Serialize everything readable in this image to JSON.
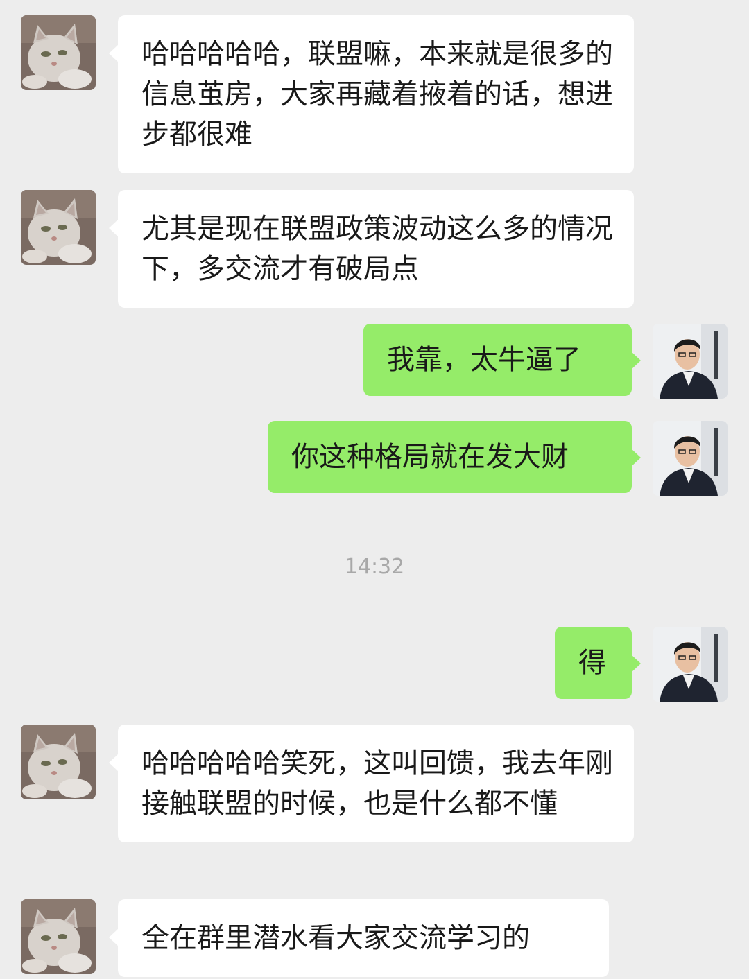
{
  "messages": [
    {
      "sender": "contact",
      "avatar": "cat-avatar",
      "text": "哈哈哈哈哈，联盟嘛，本来就是很多的信息茧房，大家再藏着掖着的话，想进步都很难"
    },
    {
      "sender": "contact",
      "avatar": "cat-avatar",
      "text": "尤其是现在联盟政策波动这么多的情况下，多交流才有破局点"
    },
    {
      "sender": "me",
      "avatar": "man-avatar",
      "text": "我靠，太牛逼了"
    },
    {
      "sender": "me",
      "avatar": "man-avatar",
      "text": "你这种格局就在发大财"
    },
    {
      "sender": "me",
      "avatar": "man-avatar",
      "text": "得"
    },
    {
      "sender": "contact",
      "avatar": "cat-avatar",
      "text": "哈哈哈哈哈笑死，这叫回馈，我去年刚接触联盟的时候，也是什么都不懂"
    },
    {
      "sender": "contact",
      "avatar": "cat-avatar",
      "text": "全在群里潜水看大家交流学习的"
    }
  ],
  "timestamp": "14:32",
  "colors": {
    "background": "#ededed",
    "incoming_bubble": "#ffffff",
    "outgoing_bubble": "#95ec69",
    "timestamp_text": "#a8a8a8"
  }
}
